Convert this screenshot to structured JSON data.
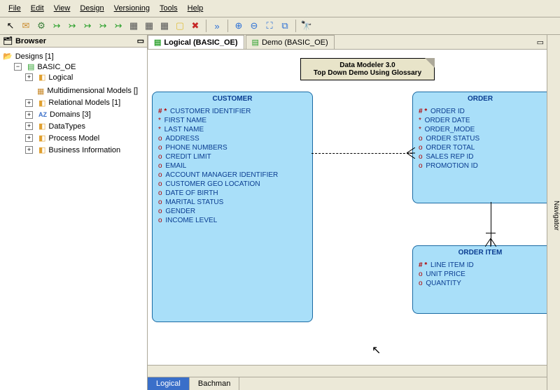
{
  "menu": [
    "File",
    "Edit",
    "View",
    "Design",
    "Versioning",
    "Tools",
    "Help"
  ],
  "browser": {
    "title": "Browser",
    "root": "Designs [1]",
    "project": "BASIC_OE",
    "nodes": [
      "Logical",
      "Multidimensional Models []",
      "Relational Models [1]",
      "Domains [3]",
      "DataTypes",
      "Process Model",
      "Business Information"
    ]
  },
  "tabs": {
    "active": "Logical (BASIC_OE)",
    "inactive": "Demo (BASIC_OE)"
  },
  "diagram": {
    "note_line1": "Data Modeler 3.0",
    "note_line2": "Top Down Demo Using Glossary",
    "entities": {
      "customer": {
        "title": "CUSTOMER",
        "attrs": [
          {
            "mark": "#*",
            "name": "CUSTOMER IDENTIFIER"
          },
          {
            "mark": "*",
            "name": "FIRST NAME"
          },
          {
            "mark": "*",
            "name": "LAST NAME"
          },
          {
            "mark": "o",
            "name": "ADDRESS"
          },
          {
            "mark": "o",
            "name": "PHONE NUMBERS"
          },
          {
            "mark": "o",
            "name": "CREDIT LIMIT"
          },
          {
            "mark": "o",
            "name": "EMAIL"
          },
          {
            "mark": "o",
            "name": "ACCOUNT MANAGER IDENTIFIER"
          },
          {
            "mark": "o",
            "name": "CUSTOMER GEO LOCATION"
          },
          {
            "mark": "o",
            "name": "DATE OF BIRTH"
          },
          {
            "mark": "o",
            "name": "MARITAL STATUS"
          },
          {
            "mark": "o",
            "name": "GENDER"
          },
          {
            "mark": "o",
            "name": "INCOME LEVEL"
          }
        ]
      },
      "order": {
        "title": "ORDER",
        "attrs": [
          {
            "mark": "#*",
            "name": "ORDER ID"
          },
          {
            "mark": "*",
            "name": "ORDER DATE"
          },
          {
            "mark": "*",
            "name": "ORDER_MODE"
          },
          {
            "mark": "o",
            "name": "ORDER STATUS"
          },
          {
            "mark": "o",
            "name": "ORDER TOTAL"
          },
          {
            "mark": "o",
            "name": "SALES REP ID"
          },
          {
            "mark": "o",
            "name": "PROMOTION ID"
          }
        ]
      },
      "orderitem": {
        "title": "ORDER ITEM",
        "attrs": [
          {
            "mark": "#*",
            "name": "LINE ITEM ID"
          },
          {
            "mark": "o",
            "name": "UNIT PRICE"
          },
          {
            "mark": "o",
            "name": "QUANTITY"
          }
        ]
      }
    }
  },
  "bottom_tabs": {
    "active": "Logical",
    "other": "Bachman"
  },
  "navigator": "Navigator"
}
